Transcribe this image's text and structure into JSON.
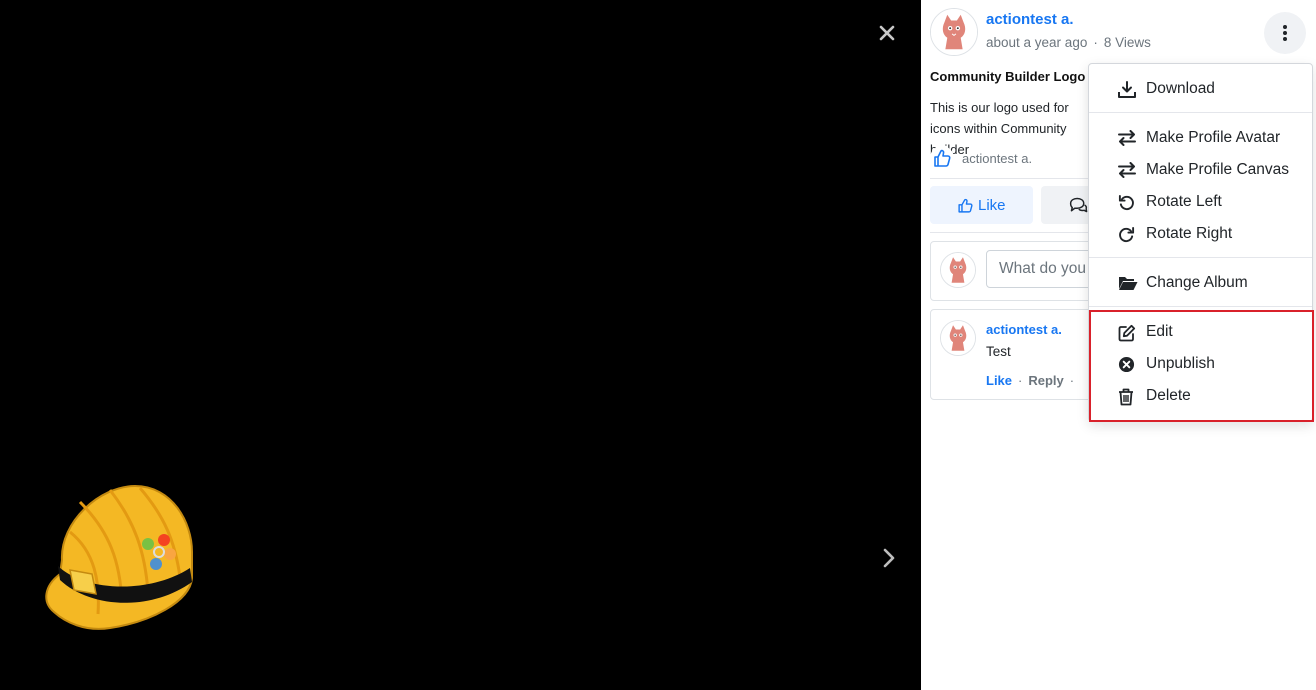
{
  "viewer": {
    "close_icon": "close-icon",
    "next_icon": "chevron-right-icon"
  },
  "post": {
    "author": "actiontest a.",
    "time": "about a year ago",
    "views": "8 Views",
    "title": "Community Builder Logo",
    "description": "This is our logo used for icons within Community builder",
    "liker": "actiontest a."
  },
  "actions": {
    "like_label": "Like"
  },
  "comment_form": {
    "placeholder": "What do you think?"
  },
  "comments": [
    {
      "author": "actiontest a.",
      "text": "Test",
      "like_label": "Like",
      "reply_label": "Reply"
    }
  ],
  "menu": {
    "items": [
      {
        "label": "Download",
        "icon": "download-icon"
      },
      {
        "label": "Make Profile Avatar",
        "icon": "swap-icon"
      },
      {
        "label": "Make Profile Canvas",
        "icon": "swap-icon"
      },
      {
        "label": "Rotate Left",
        "icon": "rotate-left-icon"
      },
      {
        "label": "Rotate Right",
        "icon": "rotate-right-icon"
      },
      {
        "label": "Change Album",
        "icon": "folder-open-icon"
      },
      {
        "label": "Edit",
        "icon": "edit-icon"
      },
      {
        "label": "Unpublish",
        "icon": "x-circle-icon"
      },
      {
        "label": "Delete",
        "icon": "trash-icon"
      }
    ]
  },
  "colors": {
    "accent": "#1877f2",
    "highlight": "#d9212b",
    "viewer_bg": "#000000"
  }
}
